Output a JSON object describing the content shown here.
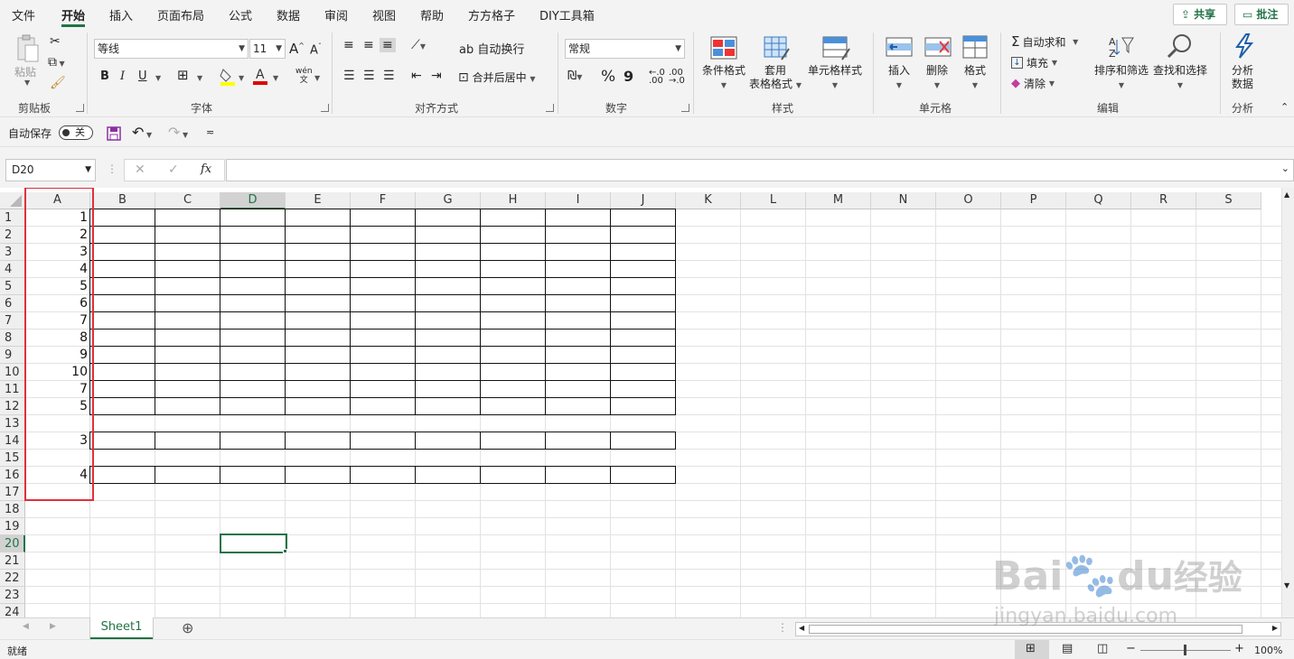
{
  "menu": {
    "tabs": [
      "文件",
      "开始",
      "插入",
      "页面布局",
      "公式",
      "数据",
      "审阅",
      "视图",
      "帮助",
      "方方格子",
      "DIY工具箱"
    ],
    "active": "开始",
    "share_label": "共享",
    "comment_label": "批注"
  },
  "ribbon": {
    "clipboard": {
      "paste_label": "粘贴",
      "group_label": "剪贴板"
    },
    "font": {
      "font_name": "等线",
      "font_size": "11",
      "bold": "B",
      "italic": "I",
      "underline": "U",
      "group_label": "字体",
      "increase": "A",
      "decrease": "A",
      "phonetic": "wén"
    },
    "align": {
      "wrap_label": "自动换行",
      "merge_label": "合并后居中",
      "group_label": "对齐方式"
    },
    "number": {
      "format": "常规",
      "percent": "%",
      "comma": "9",
      "group_label": "数字"
    },
    "styles": {
      "cond_format": "条件格式",
      "table_format_1": "套用",
      "table_format_2": "表格格式",
      "cell_styles": "单元格样式",
      "group_label": "样式"
    },
    "cells": {
      "insert": "插入",
      "delete": "删除",
      "format": "格式",
      "group_label": "单元格"
    },
    "editing": {
      "autosum": "自动求和",
      "fill": "填充",
      "clear": "清除",
      "sort": "排序和筛选",
      "find": "查找和选择",
      "group_label": "编辑"
    },
    "analysis": {
      "analyze_1": "分析",
      "analyze_2": "数据",
      "group_label": "分析"
    }
  },
  "qat": {
    "autosave_label": "自动保存",
    "toggle_label": "关"
  },
  "formula_bar": {
    "name_box": "D20",
    "fx": "fx",
    "content": ""
  },
  "columns": [
    "A",
    "B",
    "C",
    "D",
    "E",
    "F",
    "G",
    "H",
    "I",
    "J",
    "K",
    "L",
    "M",
    "N",
    "O",
    "P",
    "Q",
    "R",
    "S"
  ],
  "rows": [
    "1",
    "2",
    "3",
    "4",
    "5",
    "6",
    "7",
    "8",
    "9",
    "10",
    "11",
    "12",
    "13",
    "14",
    "15",
    "16",
    "17",
    "18",
    "19",
    "20",
    "21",
    "22",
    "23",
    "24"
  ],
  "selected_column": "D",
  "selected_row": "20",
  "column_a_values": [
    {
      "row": 1,
      "value": "1"
    },
    {
      "row": 2,
      "value": "2"
    },
    {
      "row": 3,
      "value": "3"
    },
    {
      "row": 4,
      "value": "4"
    },
    {
      "row": 5,
      "value": "5"
    },
    {
      "row": 6,
      "value": "6"
    },
    {
      "row": 7,
      "value": "7"
    },
    {
      "row": 8,
      "value": "8"
    },
    {
      "row": 9,
      "value": "9"
    },
    {
      "row": 10,
      "value": "10"
    },
    {
      "row": 11,
      "value": "7"
    },
    {
      "row": 12,
      "value": "5"
    },
    {
      "row": 14,
      "value": "3"
    },
    {
      "row": 16,
      "value": "4"
    }
  ],
  "sheet_tab": "Sheet1",
  "status": {
    "ready": "就绪",
    "zoom": "100%"
  },
  "watermark": {
    "logo": "Bai",
    "logo2": "du",
    "logo3": "经验",
    "url": "jingyan.baidu.com"
  },
  "colors": {
    "accent": "#217346",
    "highlight": "#e0303a"
  }
}
